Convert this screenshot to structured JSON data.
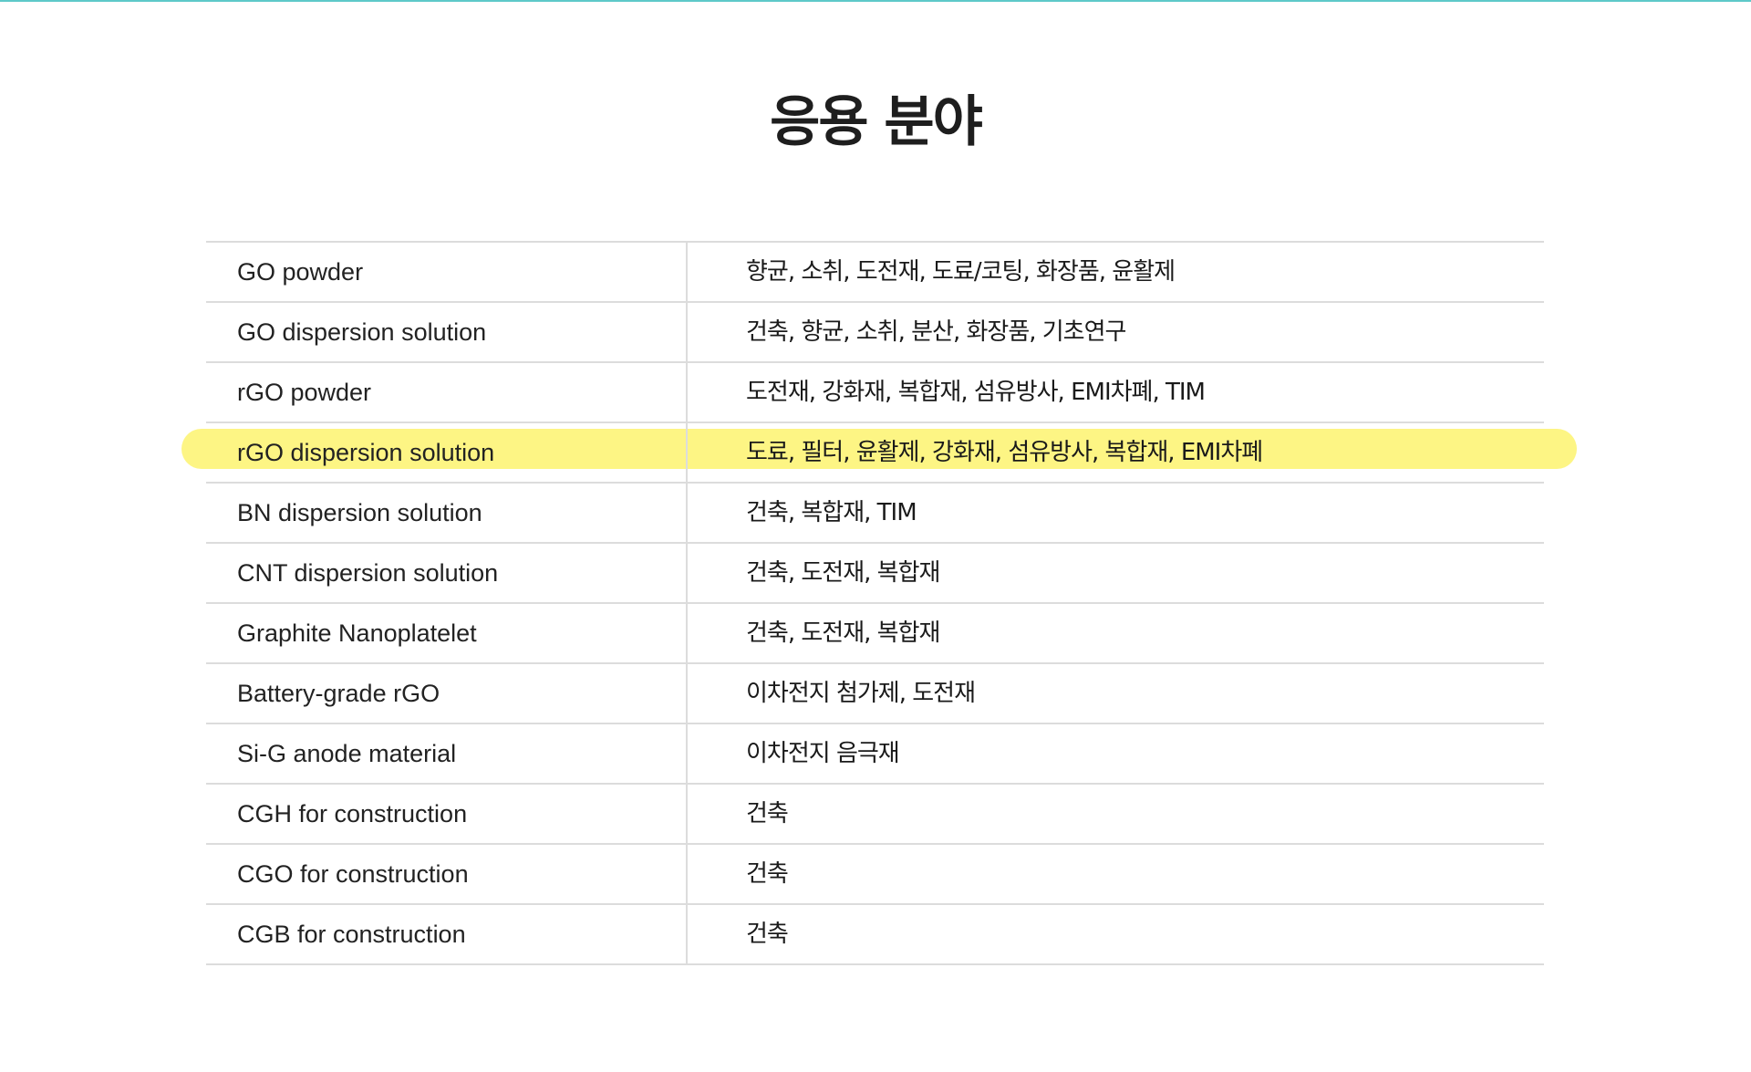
{
  "colors": {
    "accent": "#5ec9c9",
    "highlight": "#fdf584",
    "text": "#1e1e1e",
    "rule": "#dcdcdc"
  },
  "page": {
    "title": "응용 분야"
  },
  "applications": [
    {
      "product": "GO powder",
      "fields": "향균, 소취, 도전재, 도료/코팅, 화장품, 윤활제"
    },
    {
      "product": "GO dispersion solution",
      "fields": "건축, 향균, 소취, 분산, 화장품, 기초연구"
    },
    {
      "product": "rGO powder",
      "fields": "도전재, 강화재, 복합재, 섬유방사, EMI차폐, TIM"
    },
    {
      "product": "rGO dispersion solution",
      "fields": "도료, 필터, 윤활제, 강화재, 섬유방사, 복합재, EMI차폐",
      "highlighted": true
    },
    {
      "product": "BN dispersion solution",
      "fields": "건축, 복합재, TIM"
    },
    {
      "product": "CNT dispersion solution",
      "fields": "건축, 도전재, 복합재"
    },
    {
      "product": "Graphite Nanoplatelet",
      "fields": "건축, 도전재, 복합재"
    },
    {
      "product": "Battery-grade rGO",
      "fields": "이차전지 첨가제, 도전재"
    },
    {
      "product": "Si-G anode material",
      "fields": "이차전지 음극재"
    },
    {
      "product": "CGH for construction",
      "fields": "건축"
    },
    {
      "product": "CGO for construction",
      "fields": "건축"
    },
    {
      "product": "CGB for construction",
      "fields": "건축"
    }
  ]
}
